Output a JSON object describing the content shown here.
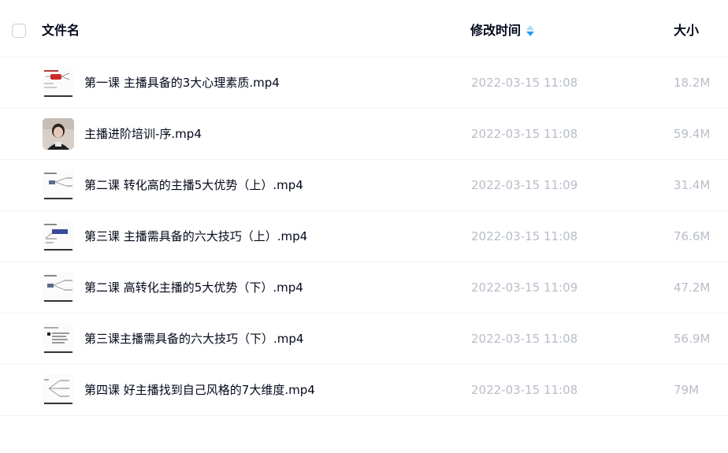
{
  "header": {
    "name_label": "文件名",
    "time_label": "修改时间",
    "size_label": "大小"
  },
  "files": [
    {
      "name": "第一课 主播具备的3大心理素质.mp4",
      "time": "2022-03-15 11:08",
      "size": "18.2M",
      "thumb": "mindmap-red-thumbnail"
    },
    {
      "name": "主播进阶培训-序.mp4",
      "time": "2022-03-15 11:08",
      "size": "59.4M",
      "thumb": "person-video-thumbnail"
    },
    {
      "name": "第二课 转化高的主播5大优势（上）.mp4",
      "time": "2022-03-15 11:09",
      "size": "31.4M",
      "thumb": "mindmap-thumbnail"
    },
    {
      "name": "第三课 主播需具备的六大技巧（上）.mp4",
      "time": "2022-03-15 11:08",
      "size": "76.6M",
      "thumb": "mindmap-blue-thumbnail"
    },
    {
      "name": "第二课 高转化主播的5大优势（下）.mp4",
      "time": "2022-03-15 11:09",
      "size": "47.2M",
      "thumb": "mindmap-thumbnail"
    },
    {
      "name": "第三课主播需具备的六大技巧（下）.mp4",
      "time": "2022-03-15 11:08",
      "size": "56.9M",
      "thumb": "slide-list-thumbnail"
    },
    {
      "name": "第四课 好主播找到自己风格的7大维度.mp4",
      "time": "2022-03-15 11:08",
      "size": "79M",
      "thumb": "mindmap-thumbnail"
    }
  ]
}
